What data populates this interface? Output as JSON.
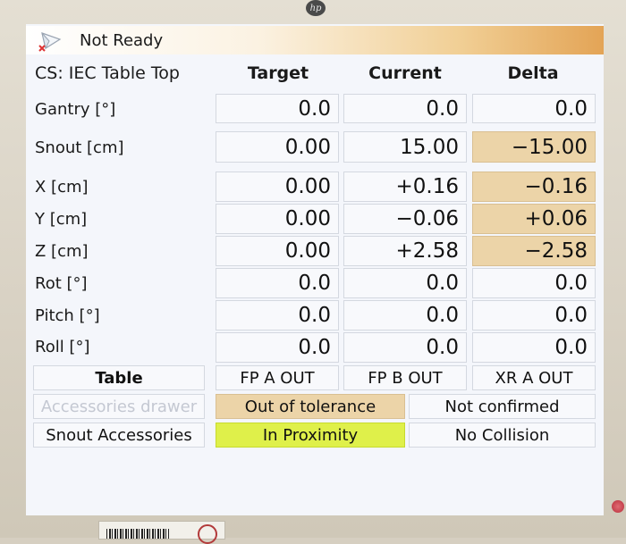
{
  "title": {
    "status": "Not Ready",
    "icon": "app-logo-icon"
  },
  "header": {
    "cs_label": "CS: IEC Table Top",
    "columns": [
      "Target",
      "Current",
      "Delta"
    ]
  },
  "rows": [
    {
      "label": "Gantry [°]",
      "target": "0.0",
      "current": "0.0",
      "delta": "0.0",
      "delta_highlight": false
    },
    {
      "label": "Snout [cm]",
      "target": "0.00",
      "current": "15.00",
      "delta": "−15.00",
      "delta_highlight": true
    },
    {
      "label": "X [cm]",
      "target": "0.00",
      "current": "+0.16",
      "delta": "−0.16",
      "delta_highlight": true
    },
    {
      "label": "Y [cm]",
      "target": "0.00",
      "current": "−0.06",
      "delta": "+0.06",
      "delta_highlight": true
    },
    {
      "label": "Z [cm]",
      "target": "0.00",
      "current": "+2.58",
      "delta": "−2.58",
      "delta_highlight": true
    },
    {
      "label": "Rot [°]",
      "target": "0.0",
      "current": "0.0",
      "delta": "0.0",
      "delta_highlight": false
    },
    {
      "label": "Pitch [°]",
      "target": "0.0",
      "current": "0.0",
      "delta": "0.0",
      "delta_highlight": false
    },
    {
      "label": "Roll [°]",
      "target": "0.0",
      "current": "0.0",
      "delta": "0.0",
      "delta_highlight": false
    }
  ],
  "status": {
    "table_label": "Table",
    "fp_a": "FP A OUT",
    "fp_b": "FP B OUT",
    "xr_a": "XR A OUT",
    "accessories_drawer_label": "Accessories drawer",
    "accessories_drawer_state": "Out of tolerance",
    "accessories_confirm": "Not confirmed",
    "snout_accessories_label": "Snout Accessories",
    "snout_proximity": "In Proximity",
    "collision": "No Collision"
  },
  "colors": {
    "delta_highlight": "#ecd4a8",
    "proximity": "#dff04a",
    "title_gradient_end": "#e3a456"
  },
  "monitor": {
    "brand_logo": "hp"
  }
}
